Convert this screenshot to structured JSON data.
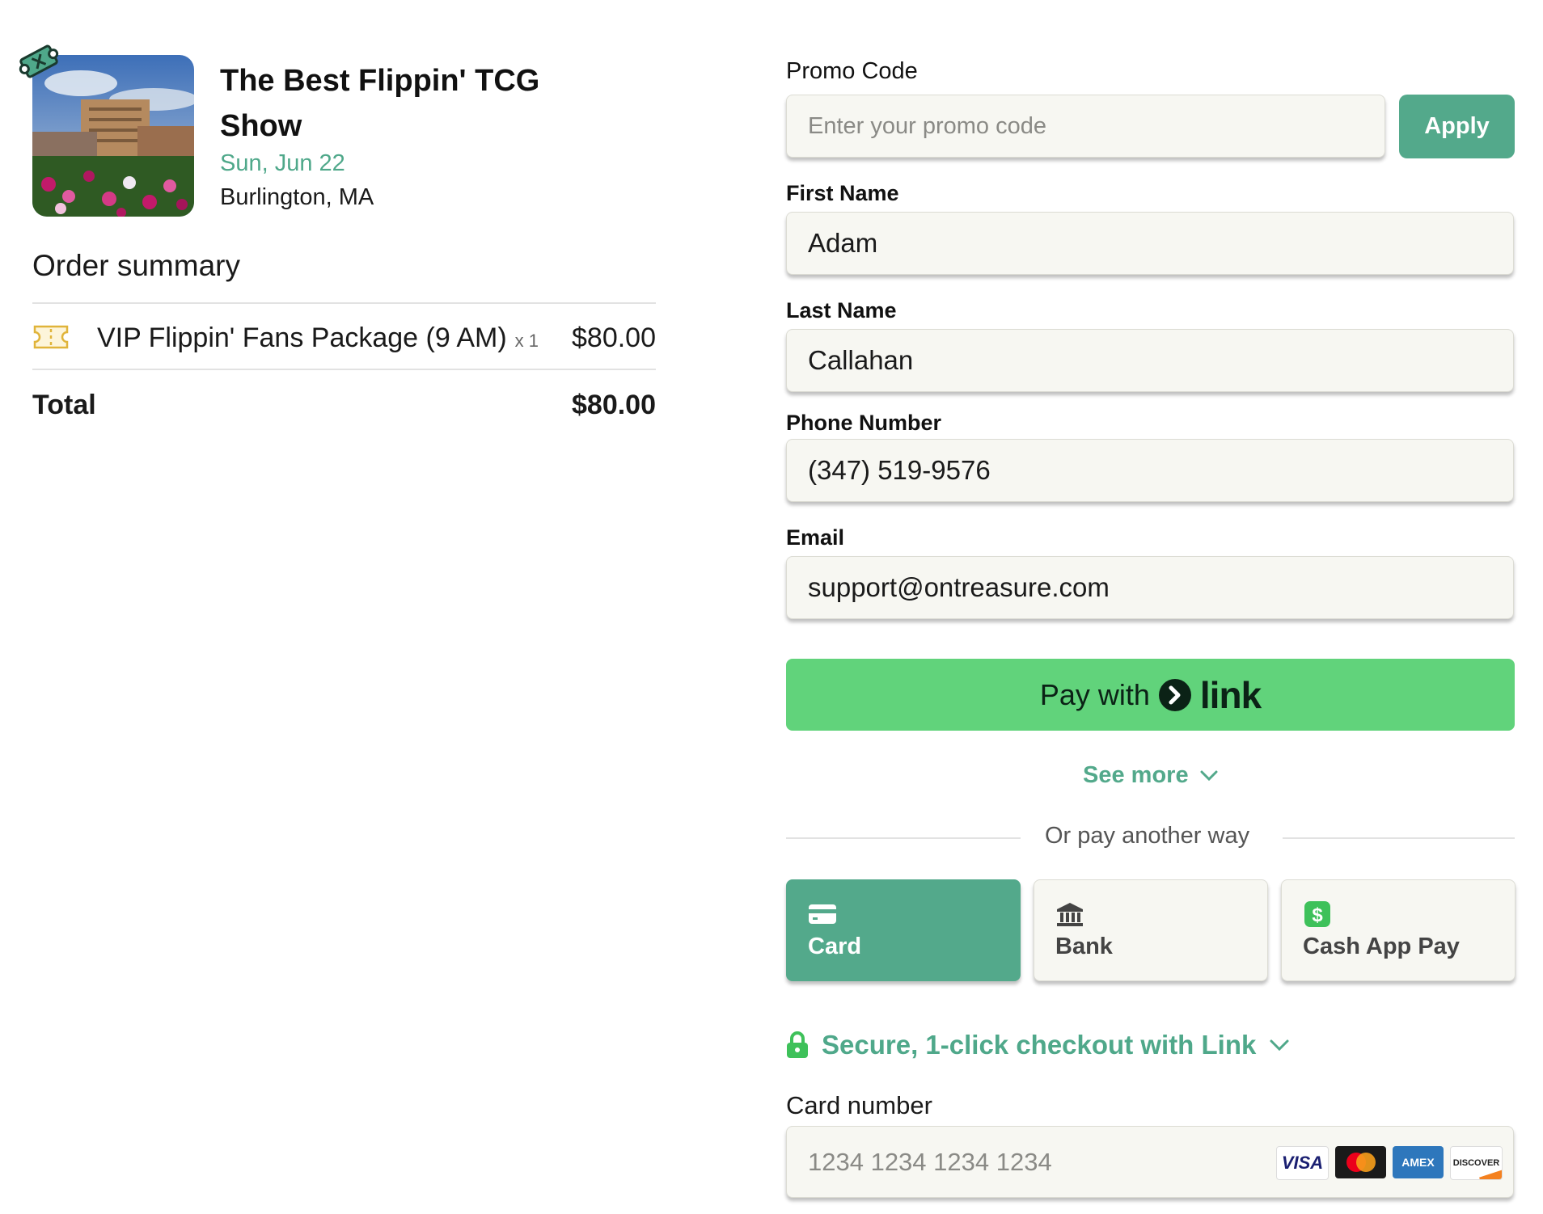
{
  "event": {
    "title": "The Best Flippin' TCG Show",
    "date": "Sun, Jun 22",
    "location": "Burlington, MA"
  },
  "order": {
    "heading": "Order summary",
    "items": [
      {
        "name": "VIP Flippin' Fans Package (9 AM)",
        "qty": "x 1",
        "price": "$80.00"
      }
    ],
    "total_label": "Total",
    "total_value": "$80.00"
  },
  "form": {
    "promo": {
      "label": "Promo Code",
      "placeholder": "Enter your promo code",
      "apply_label": "Apply"
    },
    "first_name": {
      "label": "First Name",
      "value": "Adam"
    },
    "last_name": {
      "label": "Last Name",
      "value": "Callahan"
    },
    "phone": {
      "label": "Phone Number",
      "value": "(347) 519-9576"
    },
    "email": {
      "label": "Email",
      "value": "support@ontreasure.com"
    }
  },
  "payment": {
    "link_button": {
      "prefix": "Pay with",
      "brand": "link"
    },
    "see_more": "See more",
    "or_text": "Or pay another way",
    "methods": [
      {
        "label": "Card",
        "icon": "card-icon",
        "selected": true
      },
      {
        "label": "Bank",
        "icon": "bank-icon",
        "selected": false
      },
      {
        "label": "Cash App Pay",
        "icon": "cash-app-icon",
        "selected": false
      }
    ],
    "secure_text": "Secure, 1-click checkout with Link",
    "card_number": {
      "label": "Card number",
      "placeholder": "1234 1234 1234 1234"
    },
    "card_brands": [
      "VISA",
      "Mastercard",
      "AMEX",
      "DISCOVER"
    ]
  },
  "colors": {
    "accent": "#53a98b",
    "link_green": "#61d37b",
    "field_bg": "#f7f7f2"
  }
}
